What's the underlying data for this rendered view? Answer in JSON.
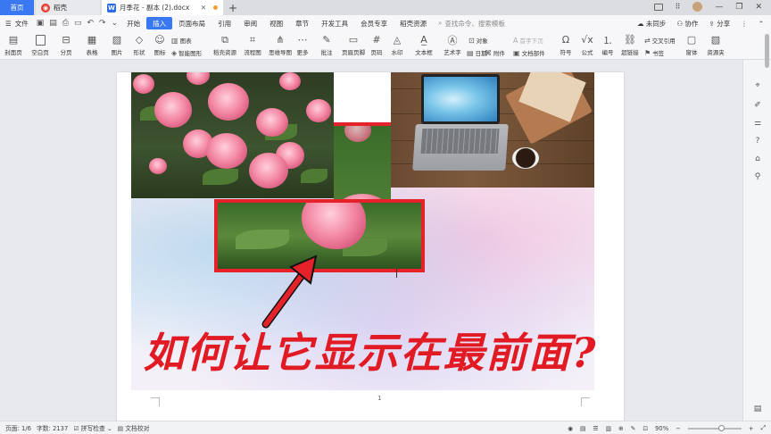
{
  "tabs": {
    "home": "首页",
    "daoke": "稻壳",
    "doc": "月季花 - 副本 (2).docx",
    "new_tab": "+"
  },
  "window": {
    "icons": [
      "layout-icon",
      "avatar",
      "minimize-icon",
      "restore-icon",
      "close-icon"
    ]
  },
  "menubar": {
    "file": "文件",
    "items": [
      "开始",
      "插入",
      "页面布局",
      "引用",
      "审阅",
      "视图",
      "章节",
      "开发工具",
      "会员专享",
      "稻壳资源"
    ],
    "active": "插入",
    "search_placeholder": "查找命令、搜索模板",
    "right": {
      "sync": "未同步",
      "collab": "协作",
      "share": "分享"
    }
  },
  "ribbon": {
    "large": [
      {
        "label": "封面页",
        "icon": "cover-page-icon"
      },
      {
        "label": "空白页",
        "icon": "blank-page-icon"
      },
      {
        "label": "分页",
        "icon": "page-break-icon"
      },
      {
        "label": "表格",
        "icon": "table-icon"
      },
      {
        "label": "图片",
        "icon": "picture-icon"
      },
      {
        "label": "形状",
        "icon": "shape-icon"
      },
      {
        "label": "图标",
        "icon": "icons-icon"
      },
      {
        "label": "稻壳资源",
        "icon": "resource-icon"
      },
      {
        "label": "流程图",
        "icon": "flowchart-icon"
      },
      {
        "label": "思维导图",
        "icon": "mindmap-icon"
      },
      {
        "label": "更多",
        "icon": "more-icon"
      },
      {
        "label": "批注",
        "icon": "comment-icon"
      },
      {
        "label": "页眉页脚",
        "icon": "header-footer-icon"
      },
      {
        "label": "页码",
        "icon": "page-number-icon"
      },
      {
        "label": "水印",
        "icon": "watermark-icon"
      },
      {
        "label": "文本框",
        "icon": "textbox-icon"
      },
      {
        "label": "艺术字",
        "icon": "wordart-icon"
      },
      {
        "label": "日期",
        "icon": "date-icon"
      },
      {
        "label": "附件",
        "icon": "attachment-icon"
      },
      {
        "label": "符号",
        "icon": "symbol-icon"
      },
      {
        "label": "公式",
        "icon": "formula-icon"
      },
      {
        "label": "编号",
        "icon": "numbering-icon"
      },
      {
        "label": "超链接",
        "icon": "hyperlink-icon"
      },
      {
        "label": "书签",
        "icon": "bookmark-icon"
      },
      {
        "label": "窗体",
        "icon": "form-icon"
      },
      {
        "label": "资源夹",
        "icon": "resource-folder-icon"
      }
    ],
    "small": {
      "chart": "图表",
      "smart_shape": "智能图形",
      "object": "对象",
      "drop_cap": "首字下沉",
      "doc_parts": "文档部件",
      "cross_ref": "交叉引用"
    }
  },
  "document": {
    "overlay_text": "如何让它显示在最前面?",
    "page_number": "1"
  },
  "statusbar": {
    "page": "页面: 1/6",
    "words": "字数: 2137",
    "spell": "拼写检查",
    "proof": "文档校对",
    "zoom": "90%"
  },
  "colors": {
    "accent": "#3a78f2",
    "highlight_red": "#e5222a"
  }
}
